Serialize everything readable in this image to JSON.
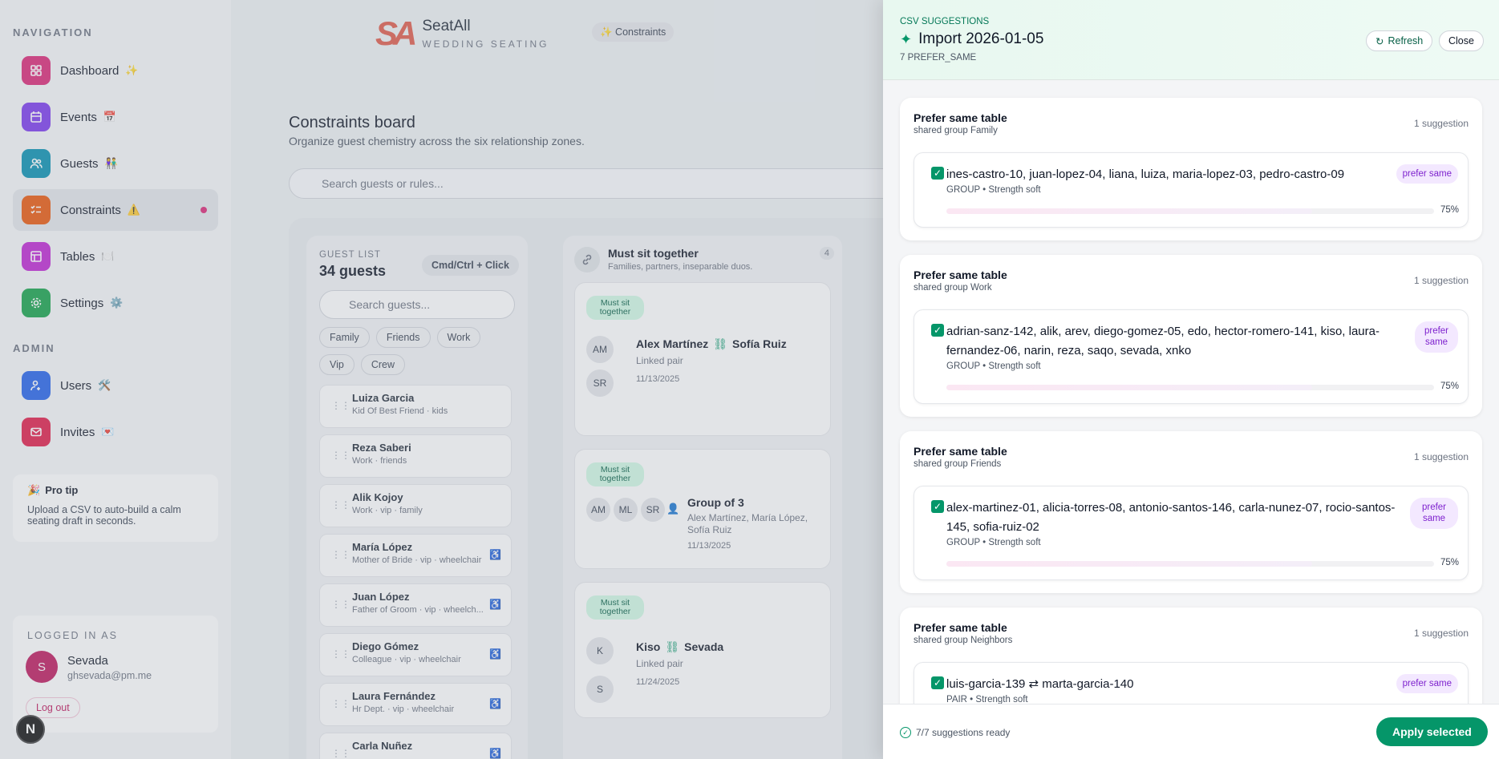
{
  "brand": {
    "name": "SeatAll",
    "tagline": "WEDDING SEATING",
    "mark": "SA",
    "header_chip": "✨ Constraints"
  },
  "sidebar": {
    "nav_heading": "NAVIGATION",
    "nav": [
      {
        "label": "Dashboard",
        "emoji": "✨",
        "color": "#db2777",
        "icon": "grid-icon"
      },
      {
        "label": "Events",
        "emoji": "📅",
        "color": "#7c3aed",
        "icon": "calendar-icon"
      },
      {
        "label": "Guests",
        "emoji": "👫",
        "color": "#0891b2",
        "icon": "people-icon"
      },
      {
        "label": "Constraints",
        "emoji": "⚠️",
        "color": "#ea580c",
        "icon": "checklist-icon",
        "active": true
      },
      {
        "label": "Tables",
        "emoji": "🍽️",
        "color": "#c026d3",
        "icon": "table-icon"
      },
      {
        "label": "Settings",
        "emoji": "⚙️",
        "color": "#16a34a",
        "icon": "gear-icon"
      }
    ],
    "admin_heading": "ADMIN",
    "admin": [
      {
        "label": "Users",
        "emoji": "🛠️",
        "color": "#2563eb",
        "icon": "user-icon"
      },
      {
        "label": "Invites",
        "emoji": "💌",
        "color": "#e11d48",
        "icon": "mail-icon"
      }
    ],
    "tip": {
      "title": "Pro tip",
      "text": "Upload a CSV to auto-build a calm seating draft in seconds."
    },
    "login": {
      "label": "LOGGED IN AS",
      "initial": "S",
      "name": "Sevada",
      "email": "ghsevada@pm.me",
      "logout": "Log out"
    }
  },
  "main": {
    "title": "Constraints board",
    "subtitle": "Organize guest chemistry across the six relationship zones.",
    "search_placeholder": "Search guests or rules...",
    "guest_list": {
      "label": "GUEST LIST",
      "count": "34 guests",
      "cmd": "Cmd/Ctrl + Click",
      "search_placeholder": "Search guests...",
      "filters": [
        "Family",
        "Friends",
        "Work",
        "Vip",
        "Crew"
      ],
      "guests": [
        {
          "name": "Luiza Garcia",
          "meta": "Kid Of Best Friend · kids",
          "wheelchair": false
        },
        {
          "name": "Reza Saberi",
          "meta": "Work · friends",
          "wheelchair": false
        },
        {
          "name": "Alik Kojoy",
          "meta": "Work · vip · family",
          "wheelchair": false
        },
        {
          "name": "María López",
          "meta": "Mother of Bride · vip · wheelchair",
          "wheelchair": true
        },
        {
          "name": "Juan López",
          "meta": "Father of Groom · vip · wheelch...",
          "wheelchair": true
        },
        {
          "name": "Diego Gómez",
          "meta": "Colleague · vip · wheelchair",
          "wheelchair": true
        },
        {
          "name": "Laura Fernández",
          "meta": "Hr Dept. · vip · wheelchair",
          "wheelchair": true
        },
        {
          "name": "Carla Nuñez",
          "meta": "",
          "wheelchair": true
        }
      ]
    },
    "zone": {
      "title": "Must sit together",
      "subtitle": "Families, partners, inseparable duos.",
      "count": "4",
      "tag": "Must sit together",
      "rules": [
        {
          "a": "Alex Martínez",
          "b": "Sofía Ruiz",
          "ia": "AM",
          "ib": "SR",
          "sub": "Linked pair",
          "date": "11/13/2025"
        },
        {
          "title": "Group of 3",
          "members": "Alex Martínez, María López, Sofía Ruiz",
          "initials": [
            "AM",
            "ML",
            "SR"
          ],
          "date": "11/13/2025"
        },
        {
          "a": "Kiso",
          "b": "Sevada",
          "ia": "K",
          "ib": "S",
          "sub": "Linked pair",
          "date": "11/24/2025"
        }
      ]
    }
  },
  "drawer": {
    "kicker": "CSV SUGGESTIONS",
    "title": "Import 2026-01-05",
    "subtitle": "7 PREFER_SAME",
    "refresh": "Refresh",
    "close": "Close",
    "groups": [
      {
        "title": "Prefer same table",
        "sub": "shared group Family",
        "count": "1 suggestion",
        "names": "ines-castro-10, juan-lopez-04, liana, luiza, maria-lopez-03, pedro-castro-09",
        "meta": "GROUP • Strength soft",
        "badge": "prefer same",
        "pct": "75%",
        "progress": 0.75
      },
      {
        "title": "Prefer same table",
        "sub": "shared group Work",
        "count": "1 suggestion",
        "names": "adrian-sanz-142, alik, arev, diego-gomez-05, edo, hector-romero-141, kiso, laura-fernandez-06, narin, reza, saqo, sevada, xnko",
        "meta": "GROUP • Strength soft",
        "badge": "prefer same",
        "pct": "75%",
        "progress": 0.75
      },
      {
        "title": "Prefer same table",
        "sub": "shared group Friends",
        "count": "1 suggestion",
        "names": "alex-martinez-01, alicia-torres-08, antonio-santos-146, carla-nunez-07, rocio-santos-145, sofia-ruiz-02",
        "meta": "GROUP • Strength soft",
        "badge": "prefer same",
        "pct": "75%",
        "progress": 0.75
      },
      {
        "title": "Prefer same table",
        "sub": "shared group Neighbors",
        "count": "1 suggestion",
        "names": "luis-garcia-139 ⇄ marta-garcia-140",
        "meta": "PAIR • Strength soft",
        "badge": "prefer same"
      }
    ],
    "status": "7/7 suggestions ready",
    "apply": "Apply selected"
  }
}
